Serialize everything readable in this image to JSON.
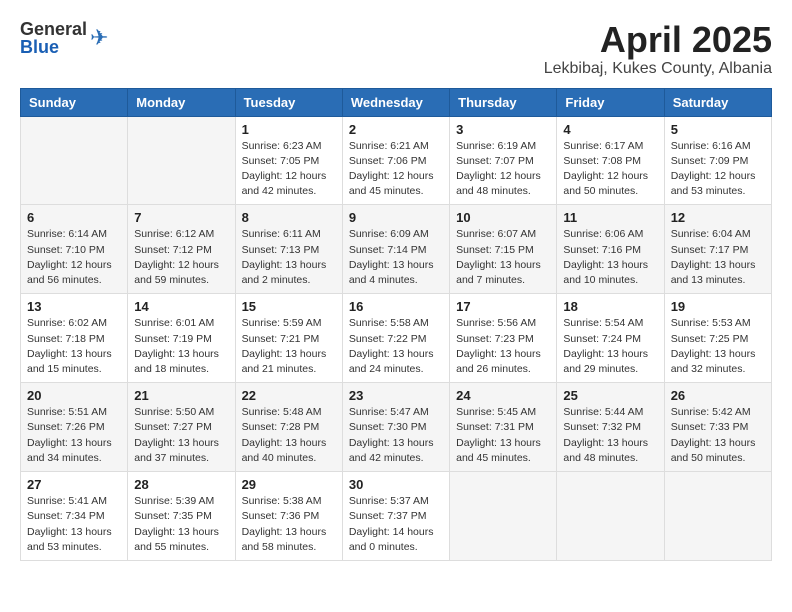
{
  "header": {
    "logo_general": "General",
    "logo_blue": "Blue",
    "month": "April 2025",
    "location": "Lekbibaj, Kukes County, Albania"
  },
  "weekdays": [
    "Sunday",
    "Monday",
    "Tuesday",
    "Wednesday",
    "Thursday",
    "Friday",
    "Saturday"
  ],
  "weeks": [
    [
      {
        "day": "",
        "sunrise": "",
        "sunset": "",
        "daylight": ""
      },
      {
        "day": "",
        "sunrise": "",
        "sunset": "",
        "daylight": ""
      },
      {
        "day": "1",
        "sunrise": "Sunrise: 6:23 AM",
        "sunset": "Sunset: 7:05 PM",
        "daylight": "Daylight: 12 hours and 42 minutes."
      },
      {
        "day": "2",
        "sunrise": "Sunrise: 6:21 AM",
        "sunset": "Sunset: 7:06 PM",
        "daylight": "Daylight: 12 hours and 45 minutes."
      },
      {
        "day": "3",
        "sunrise": "Sunrise: 6:19 AM",
        "sunset": "Sunset: 7:07 PM",
        "daylight": "Daylight: 12 hours and 48 minutes."
      },
      {
        "day": "4",
        "sunrise": "Sunrise: 6:17 AM",
        "sunset": "Sunset: 7:08 PM",
        "daylight": "Daylight: 12 hours and 50 minutes."
      },
      {
        "day": "5",
        "sunrise": "Sunrise: 6:16 AM",
        "sunset": "Sunset: 7:09 PM",
        "daylight": "Daylight: 12 hours and 53 minutes."
      }
    ],
    [
      {
        "day": "6",
        "sunrise": "Sunrise: 6:14 AM",
        "sunset": "Sunset: 7:10 PM",
        "daylight": "Daylight: 12 hours and 56 minutes."
      },
      {
        "day": "7",
        "sunrise": "Sunrise: 6:12 AM",
        "sunset": "Sunset: 7:12 PM",
        "daylight": "Daylight: 12 hours and 59 minutes."
      },
      {
        "day": "8",
        "sunrise": "Sunrise: 6:11 AM",
        "sunset": "Sunset: 7:13 PM",
        "daylight": "Daylight: 13 hours and 2 minutes."
      },
      {
        "day": "9",
        "sunrise": "Sunrise: 6:09 AM",
        "sunset": "Sunset: 7:14 PM",
        "daylight": "Daylight: 13 hours and 4 minutes."
      },
      {
        "day": "10",
        "sunrise": "Sunrise: 6:07 AM",
        "sunset": "Sunset: 7:15 PM",
        "daylight": "Daylight: 13 hours and 7 minutes."
      },
      {
        "day": "11",
        "sunrise": "Sunrise: 6:06 AM",
        "sunset": "Sunset: 7:16 PM",
        "daylight": "Daylight: 13 hours and 10 minutes."
      },
      {
        "day": "12",
        "sunrise": "Sunrise: 6:04 AM",
        "sunset": "Sunset: 7:17 PM",
        "daylight": "Daylight: 13 hours and 13 minutes."
      }
    ],
    [
      {
        "day": "13",
        "sunrise": "Sunrise: 6:02 AM",
        "sunset": "Sunset: 7:18 PM",
        "daylight": "Daylight: 13 hours and 15 minutes."
      },
      {
        "day": "14",
        "sunrise": "Sunrise: 6:01 AM",
        "sunset": "Sunset: 7:19 PM",
        "daylight": "Daylight: 13 hours and 18 minutes."
      },
      {
        "day": "15",
        "sunrise": "Sunrise: 5:59 AM",
        "sunset": "Sunset: 7:21 PM",
        "daylight": "Daylight: 13 hours and 21 minutes."
      },
      {
        "day": "16",
        "sunrise": "Sunrise: 5:58 AM",
        "sunset": "Sunset: 7:22 PM",
        "daylight": "Daylight: 13 hours and 24 minutes."
      },
      {
        "day": "17",
        "sunrise": "Sunrise: 5:56 AM",
        "sunset": "Sunset: 7:23 PM",
        "daylight": "Daylight: 13 hours and 26 minutes."
      },
      {
        "day": "18",
        "sunrise": "Sunrise: 5:54 AM",
        "sunset": "Sunset: 7:24 PM",
        "daylight": "Daylight: 13 hours and 29 minutes."
      },
      {
        "day": "19",
        "sunrise": "Sunrise: 5:53 AM",
        "sunset": "Sunset: 7:25 PM",
        "daylight": "Daylight: 13 hours and 32 minutes."
      }
    ],
    [
      {
        "day": "20",
        "sunrise": "Sunrise: 5:51 AM",
        "sunset": "Sunset: 7:26 PM",
        "daylight": "Daylight: 13 hours and 34 minutes."
      },
      {
        "day": "21",
        "sunrise": "Sunrise: 5:50 AM",
        "sunset": "Sunset: 7:27 PM",
        "daylight": "Daylight: 13 hours and 37 minutes."
      },
      {
        "day": "22",
        "sunrise": "Sunrise: 5:48 AM",
        "sunset": "Sunset: 7:28 PM",
        "daylight": "Daylight: 13 hours and 40 minutes."
      },
      {
        "day": "23",
        "sunrise": "Sunrise: 5:47 AM",
        "sunset": "Sunset: 7:30 PM",
        "daylight": "Daylight: 13 hours and 42 minutes."
      },
      {
        "day": "24",
        "sunrise": "Sunrise: 5:45 AM",
        "sunset": "Sunset: 7:31 PM",
        "daylight": "Daylight: 13 hours and 45 minutes."
      },
      {
        "day": "25",
        "sunrise": "Sunrise: 5:44 AM",
        "sunset": "Sunset: 7:32 PM",
        "daylight": "Daylight: 13 hours and 48 minutes."
      },
      {
        "day": "26",
        "sunrise": "Sunrise: 5:42 AM",
        "sunset": "Sunset: 7:33 PM",
        "daylight": "Daylight: 13 hours and 50 minutes."
      }
    ],
    [
      {
        "day": "27",
        "sunrise": "Sunrise: 5:41 AM",
        "sunset": "Sunset: 7:34 PM",
        "daylight": "Daylight: 13 hours and 53 minutes."
      },
      {
        "day": "28",
        "sunrise": "Sunrise: 5:39 AM",
        "sunset": "Sunset: 7:35 PM",
        "daylight": "Daylight: 13 hours and 55 minutes."
      },
      {
        "day": "29",
        "sunrise": "Sunrise: 5:38 AM",
        "sunset": "Sunset: 7:36 PM",
        "daylight": "Daylight: 13 hours and 58 minutes."
      },
      {
        "day": "30",
        "sunrise": "Sunrise: 5:37 AM",
        "sunset": "Sunset: 7:37 PM",
        "daylight": "Daylight: 14 hours and 0 minutes."
      },
      {
        "day": "",
        "sunrise": "",
        "sunset": "",
        "daylight": ""
      },
      {
        "day": "",
        "sunrise": "",
        "sunset": "",
        "daylight": ""
      },
      {
        "day": "",
        "sunrise": "",
        "sunset": "",
        "daylight": ""
      }
    ]
  ]
}
